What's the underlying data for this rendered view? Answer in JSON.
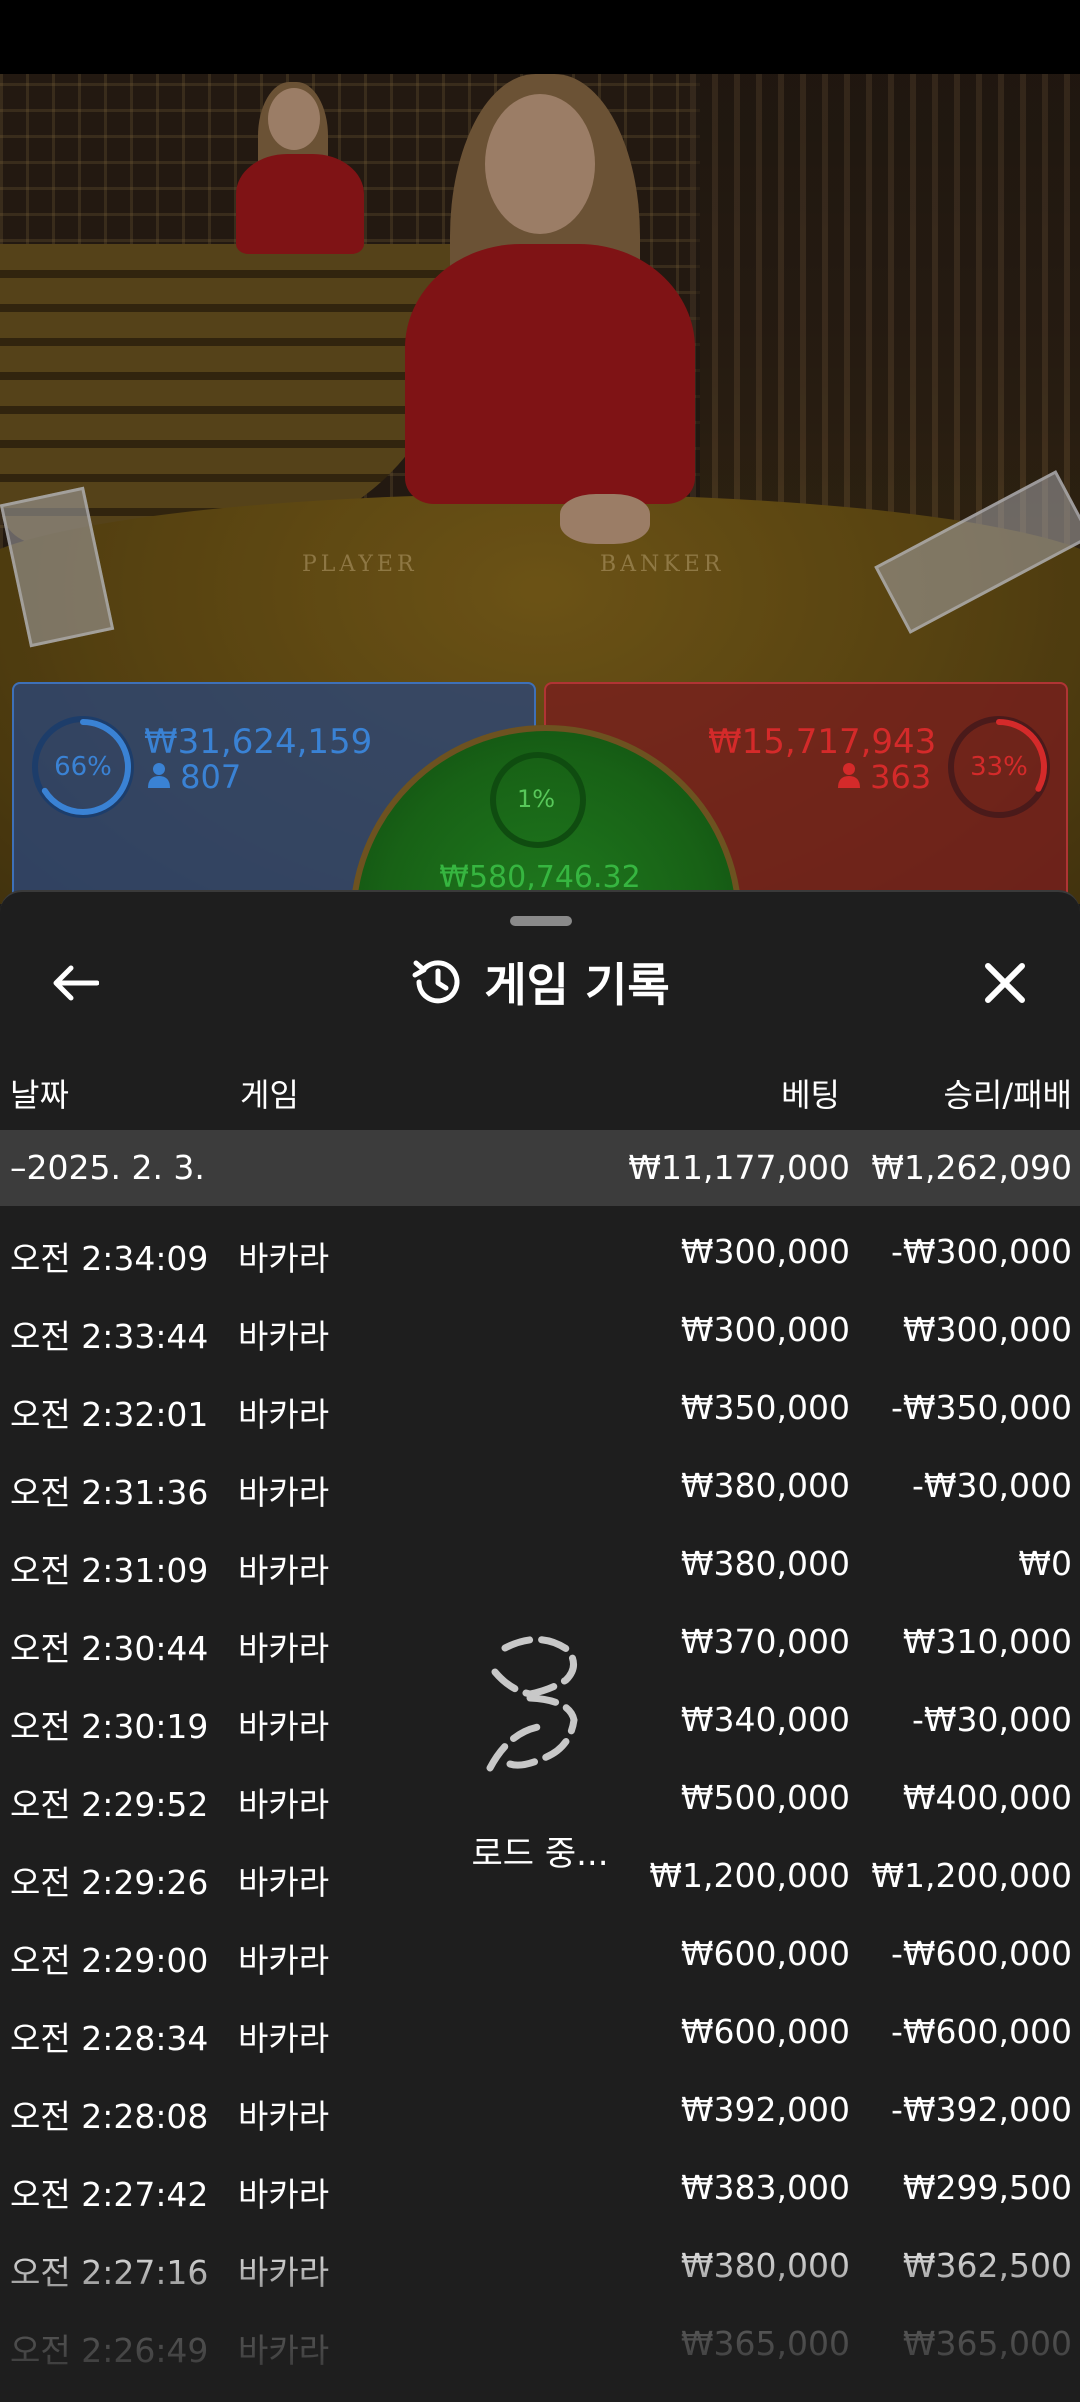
{
  "stream": {
    "table_labels": [
      "PLAYER",
      "BANKER"
    ],
    "player": {
      "percent": "66%",
      "percent_value": 0.66,
      "amount": "₩31,624,159",
      "count": "807",
      "color": "#3a82d4"
    },
    "banker": {
      "percent": "33%",
      "percent_value": 0.33,
      "amount": "₩15,717,943",
      "count": "363",
      "color": "#d42a2a"
    },
    "tie": {
      "percent": "1%",
      "amount": "₩580,746.32",
      "color": "#36b640"
    }
  },
  "history": {
    "title": "게임 기록",
    "columns": {
      "date": "날짜",
      "game": "게임",
      "bet": "베팅",
      "result": "승리/패배"
    },
    "group": {
      "date": "–2025. 2. 3.",
      "bet": "₩11,177,000",
      "result": "₩1,262,090"
    },
    "rows": [
      {
        "time": "오전 2:34:09",
        "game": "바카라",
        "bet": "₩300,000",
        "result": "-₩300,000"
      },
      {
        "time": "오전 2:33:44",
        "game": "바카라",
        "bet": "₩300,000",
        "result": "₩300,000"
      },
      {
        "time": "오전 2:32:01",
        "game": "바카라",
        "bet": "₩350,000",
        "result": "-₩350,000"
      },
      {
        "time": "오전 2:31:36",
        "game": "바카라",
        "bet": "₩380,000",
        "result": "-₩30,000"
      },
      {
        "time": "오전 2:31:09",
        "game": "바카라",
        "bet": "₩380,000",
        "result": "₩0"
      },
      {
        "time": "오전 2:30:44",
        "game": "바카라",
        "bet": "₩370,000",
        "result": "₩310,000"
      },
      {
        "time": "오전 2:30:19",
        "game": "바카라",
        "bet": "₩340,000",
        "result": "-₩30,000"
      },
      {
        "time": "오전 2:29:52",
        "game": "바카라",
        "bet": "₩500,000",
        "result": "₩400,000"
      },
      {
        "time": "오전 2:29:26",
        "game": "바카라",
        "bet": "₩1,200,000",
        "result": "₩1,200,000"
      },
      {
        "time": "오전 2:29:00",
        "game": "바카라",
        "bet": "₩600,000",
        "result": "-₩600,000"
      },
      {
        "time": "오전 2:28:34",
        "game": "바카라",
        "bet": "₩600,000",
        "result": "-₩600,000"
      },
      {
        "time": "오전 2:28:08",
        "game": "바카라",
        "bet": "₩392,000",
        "result": "-₩392,000"
      },
      {
        "time": "오전 2:27:42",
        "game": "바카라",
        "bet": "₩383,000",
        "result": "₩299,500"
      },
      {
        "time": "오전 2:27:16",
        "game": "바카라",
        "bet": "₩380,000",
        "result": "₩362,500"
      },
      {
        "time": "오전 2:26:49",
        "game": "바카라",
        "bet": "₩365,000",
        "result": "₩365,000"
      }
    ]
  },
  "loading": {
    "text": "로드 중..."
  }
}
